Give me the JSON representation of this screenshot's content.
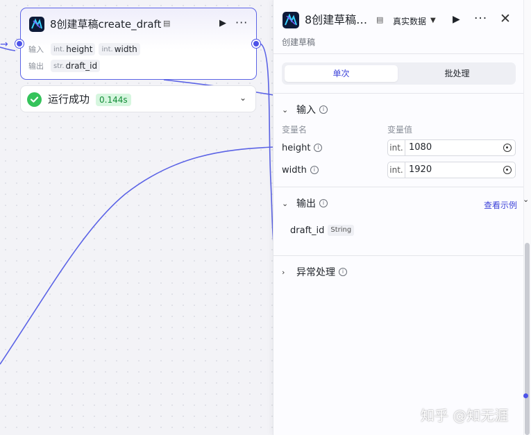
{
  "colors": {
    "accent": "#4d53e8",
    "success": "#35c35b",
    "success_text": "#138c37",
    "link": "#3e44d9"
  },
  "node": {
    "title": "8创建草稿create_draft",
    "doc_icon": "document-icon",
    "run_icon": "play-icon",
    "more_icon": "more-icon",
    "input_label": "输入",
    "output_label": "输出",
    "inputs": [
      {
        "type": "int.",
        "name": "height"
      },
      {
        "type": "int.",
        "name": "width"
      }
    ],
    "outputs": [
      {
        "type": "str.",
        "name": "draft_id"
      }
    ]
  },
  "status": {
    "text": "运行成功",
    "duration": "0.144s"
  },
  "panel": {
    "title": "8创建草稿…",
    "subtitle": "创建草稿",
    "mode": "真实数据",
    "tabs": [
      "单次",
      "批处理"
    ],
    "input_section": {
      "title": "输入",
      "col_name": "变量名",
      "col_value": "变量值",
      "rows": [
        {
          "name": "height",
          "type": "int.",
          "value": "1080"
        },
        {
          "name": "width",
          "type": "int.",
          "value": "1920"
        }
      ]
    },
    "output_section": {
      "title": "输出",
      "example_link": "查看示例",
      "rows": [
        {
          "name": "draft_id",
          "type": "String"
        }
      ]
    },
    "exception_section": {
      "title": "异常处理"
    }
  },
  "watermark": "知乎 @知无涯"
}
